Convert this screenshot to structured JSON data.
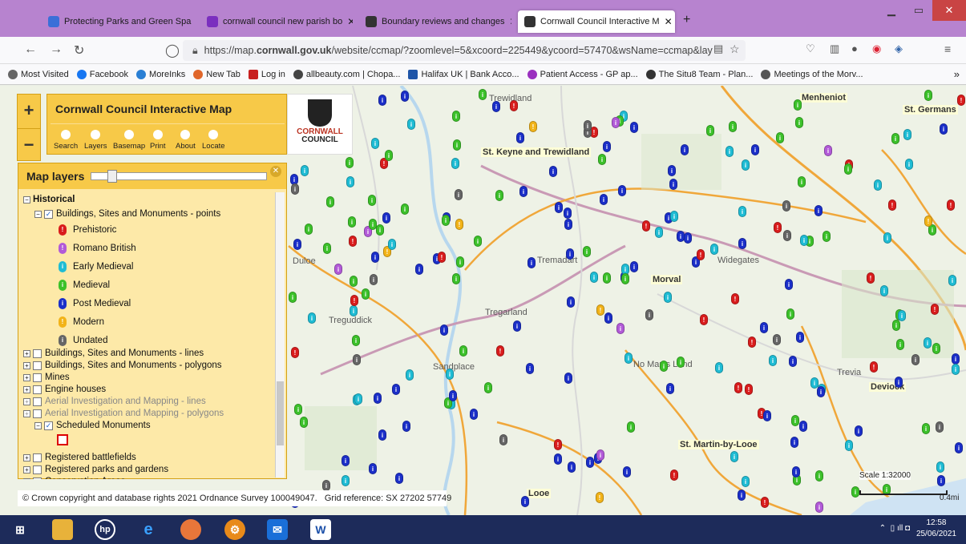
{
  "browser": {
    "tabs": [
      {
        "label": "Protecting Parks and Green Spa",
        "color": "#3b6fd8"
      },
      {
        "label": "cornwall council new parish bo",
        "color": "#7b2fbf"
      },
      {
        "label": "Boundary reviews and changes",
        "color": "#333333"
      },
      {
        "label": "Cornwall Council Interactive M",
        "color": "#333333",
        "active": true
      }
    ],
    "url_prefix": "https://map.",
    "url_domain": "cornwall.gov.uk",
    "url_rest": "/website/ccmap/?zoomlevel=5&xcoord=225449&ycoord=57470&wsName=ccmap&lay",
    "bookmarks": [
      {
        "label": "Most Visited",
        "color": "#666666"
      },
      {
        "label": "Facebook",
        "color": "#1877f2"
      },
      {
        "label": "MoreInks",
        "color": "#2a7fd4"
      },
      {
        "label": "New Tab",
        "color": "#e0662a"
      },
      {
        "label": "Log in",
        "color": "#c82020"
      },
      {
        "label": "allbeauty.com | Chopa...",
        "color": "#444444"
      },
      {
        "label": "Halifax UK | Bank Acco...",
        "color": "#1f55a8"
      },
      {
        "label": "Patient Access - GP ap...",
        "color": "#9a2fbf"
      },
      {
        "label": "The Situ8 Team - Plan...",
        "color": "#333333"
      },
      {
        "label": "Meetings of the Morv...",
        "color": "#555555"
      }
    ]
  },
  "app": {
    "title": "Cornwall Council Interactive Map",
    "tools": [
      "Search",
      "Layers",
      "Basemap",
      "Print",
      "About",
      "Locate"
    ],
    "logo_line1": "CORNWALL",
    "logo_line2": "COUNCIL"
  },
  "layers": {
    "title": "Map layers",
    "group": "Historical",
    "points_label": "Buildings, Sites and Monuments - points",
    "legend": [
      {
        "label": "Prehistoric",
        "color": "#d91c1c"
      },
      {
        "label": "Romano British",
        "color": "#b25ad8"
      },
      {
        "label": "Early Medieval",
        "color": "#1fbcd4"
      },
      {
        "label": "Medieval",
        "color": "#3cc12a"
      },
      {
        "label": "Post Medieval",
        "color": "#1b2fc9"
      },
      {
        "label": "Modern",
        "color": "#f2b318"
      },
      {
        "label": "Undated",
        "color": "#666666"
      }
    ],
    "more": [
      {
        "label": "Buildings, Sites and Monuments - lines",
        "dim": false
      },
      {
        "label": "Buildings, Sites and Monuments - polygons",
        "dim": false
      },
      {
        "label": "Mines",
        "dim": false
      },
      {
        "label": "Engine houses",
        "dim": false
      },
      {
        "label": "Aerial Investigation and Mapping - lines",
        "dim": true
      },
      {
        "label": "Aerial Investigation and Mapping - polygons",
        "dim": true
      }
    ],
    "scheduled": "Scheduled Monuments",
    "after": [
      "Registered battlefields",
      "Registered parks and gardens",
      "Conservation Areas"
    ]
  },
  "map": {
    "places": [
      "Trewidland",
      "St. Keyne and Trewidland",
      "Menheniot",
      "St. Germans",
      "Morval",
      "Widegates",
      "No Man's Land",
      "St. Martin-by-Looe",
      "Deviock",
      "Looe",
      "Tremadart",
      "Treguddick",
      "Sandplace",
      "Tregarland",
      "Trevia",
      "Duloe"
    ],
    "copyright": "© Crown copyright and database rights 2021 Ordnance Survey 100049047.",
    "grid_reference": "Grid reference:  SX 27202 57749",
    "scale_label": "Scale 1:32000",
    "scale_bar_label": "0.4mi"
  },
  "taskbar": {
    "time": "12:58",
    "date": "25/06/2021"
  }
}
